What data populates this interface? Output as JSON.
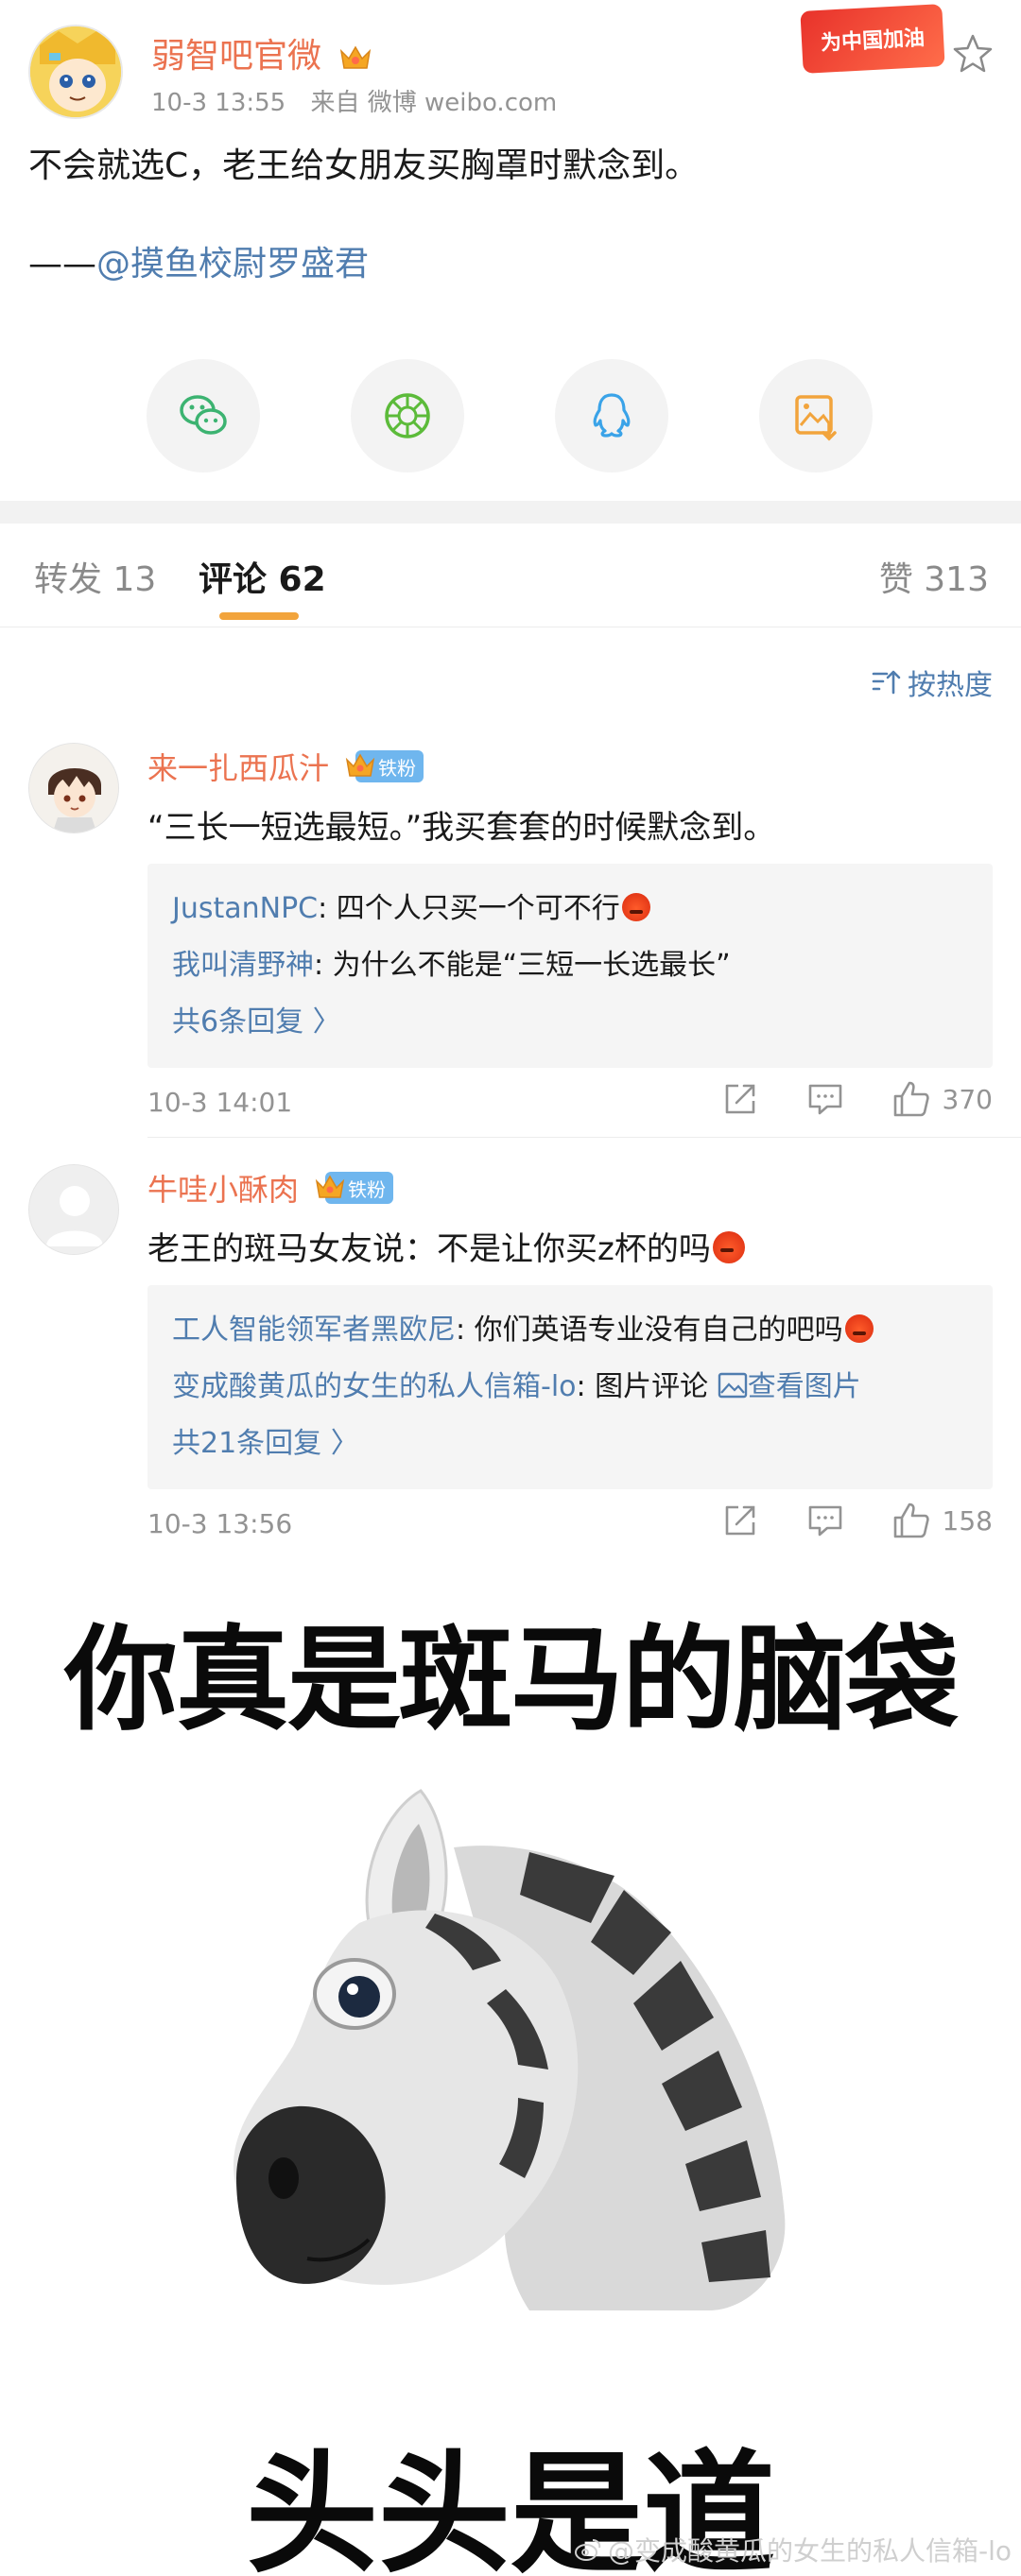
{
  "post": {
    "username": "弱智吧官微",
    "time": "10-3 13:55",
    "source": "来自 微博 weibo.com",
    "promo_badge": "为中国加油",
    "text": "不会就选C，老王给女朋友买胸罩时默念到。",
    "credit_prefix": "——",
    "credit_mention": "@摸鱼校尉罗盛君",
    "share_icons": [
      "wechat-icon",
      "moments-icon",
      "qq-icon",
      "save-image-icon"
    ]
  },
  "tabs": {
    "repost": "转发 13",
    "comments": "评论 62",
    "likes": "赞 313"
  },
  "sort": {
    "label": "按热度"
  },
  "comments": [
    {
      "user": "来一扎西瓜汁",
      "badge": "铁粉",
      "text": "“三长一短选最短。”我买套套的时候默念到。",
      "replies": [
        {
          "who": "JustanNPC",
          "text": ": 四个人只买一个可不行"
        },
        {
          "who": "我叫清野神",
          "text": ": 为什么不能是“三短一长选最长”"
        }
      ],
      "more": "共6条回复 〉",
      "time": "10-3 14:01",
      "likes": "370"
    },
    {
      "user": "牛哇小酥肉",
      "badge": "铁粉",
      "text": "老王的斑马女友说：不是让你买z杯的吗",
      "replies": [
        {
          "who": "工人智能领军者黑欧尼",
          "text": ": 你们英语专业没有自己的吧吗"
        },
        {
          "who": "变成酸黄瓜的女生的私人信箱-lo",
          "text": ": 图片评论 ",
          "link": "查看图片"
        }
      ],
      "more": "共21条回复 〉",
      "time": "10-3 13:56",
      "likes": "158"
    }
  ],
  "meme": {
    "top_text": "你真是斑马的脑袋",
    "bottom_text": "头头是道",
    "watermark": "@变成酸黄瓜的女生的私人信箱-lo"
  },
  "colors": {
    "username": "#eb7350",
    "link": "#507daf",
    "tab_underline": "#f2a43c",
    "fan_badge": "#6fb6ee",
    "muted": "#939393"
  }
}
